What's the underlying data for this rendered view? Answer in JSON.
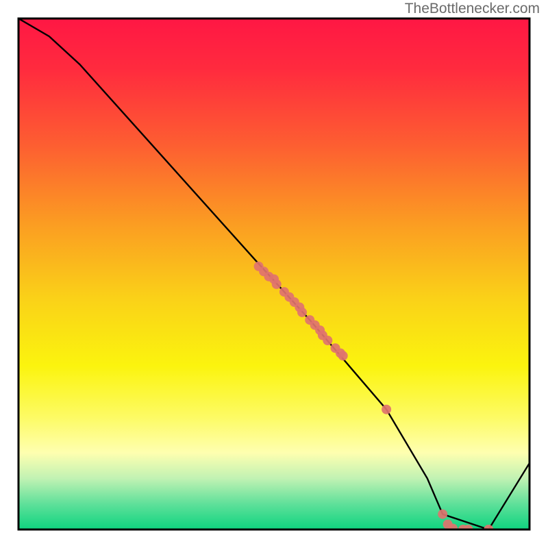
{
  "attribution": "TheBottlenecker.com",
  "chart_data": {
    "type": "line",
    "title": "",
    "xlabel": "",
    "ylabel": "",
    "xlim": [
      0,
      100
    ],
    "ylim": [
      0,
      100
    ],
    "series": [
      {
        "name": "curve",
        "x": [
          0,
          6,
          12,
          47,
          57,
          63,
          72,
          80,
          83,
          92,
          100
        ],
        "y": [
          100,
          96.5,
          91,
          52,
          41,
          34,
          23.5,
          10,
          3,
          0,
          13
        ]
      }
    ],
    "points": {
      "name": "markers",
      "color": "#e0736e",
      "x": [
        47,
        48,
        49,
        50,
        50.5,
        52,
        53,
        54,
        55,
        55.5,
        57,
        58,
        59,
        59.5,
        60.5,
        62,
        63,
        63.5,
        72,
        83,
        84,
        85,
        87,
        88,
        92
      ],
      "y": [
        51.5,
        50.5,
        49.5,
        49,
        48,
        46.5,
        45.5,
        44.5,
        43.5,
        42.5,
        41,
        40,
        39,
        38,
        37,
        35.5,
        34.5,
        34,
        23.5,
        3,
        1,
        0.2,
        0,
        0,
        0
      ]
    },
    "gradient_stops": [
      {
        "offset": 0.0,
        "color": "#ff1744"
      },
      {
        "offset": 0.1,
        "color": "#ff2b3e"
      },
      {
        "offset": 0.25,
        "color": "#fd5f31"
      },
      {
        "offset": 0.4,
        "color": "#fb9c22"
      },
      {
        "offset": 0.55,
        "color": "#fad218"
      },
      {
        "offset": 0.68,
        "color": "#fbf40e"
      },
      {
        "offset": 0.78,
        "color": "#fdfb64"
      },
      {
        "offset": 0.85,
        "color": "#feffb0"
      },
      {
        "offset": 0.9,
        "color": "#c1f2b3"
      },
      {
        "offset": 0.95,
        "color": "#5fe09a"
      },
      {
        "offset": 1.0,
        "color": "#0ed47f"
      }
    ]
  }
}
